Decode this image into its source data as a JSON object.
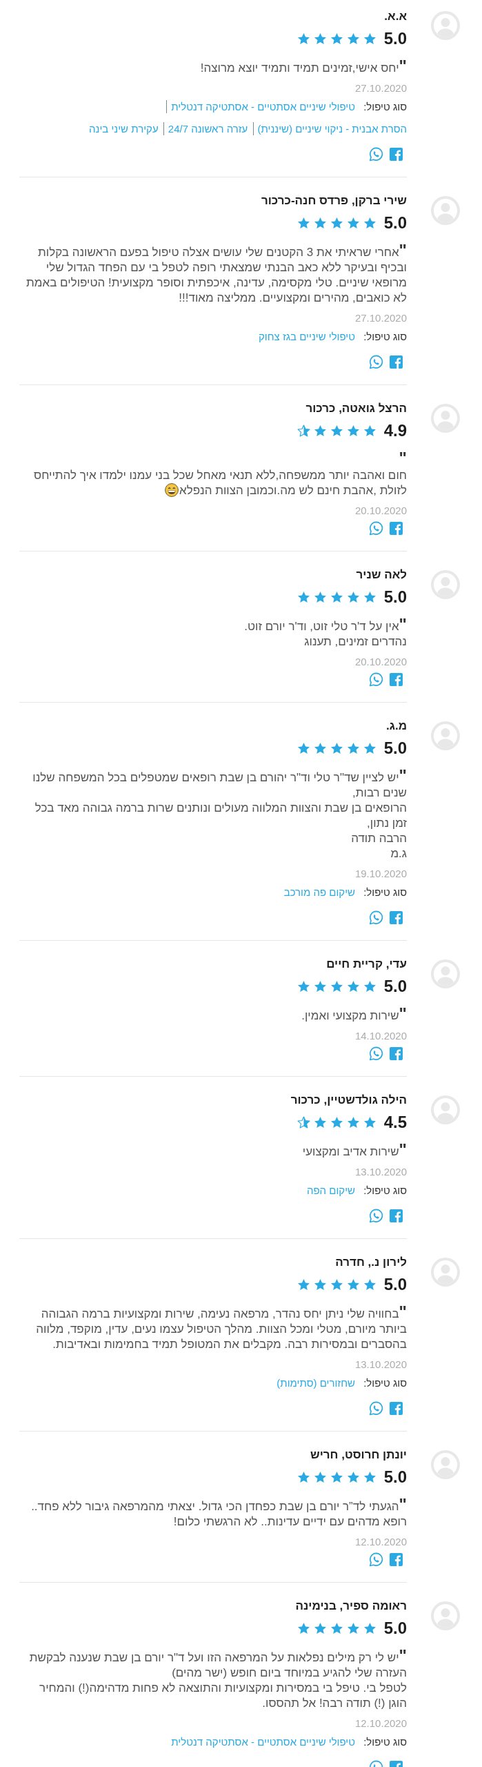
{
  "reviews": [
    {
      "name": "א.א.",
      "score": "5.0",
      "stars": 5,
      "text": "**\"**יחס אישי,זמינים תמיד ותמיד יוצא מרוצה!",
      "date": "27.10.2020",
      "treatment_label": "סוג טיפול:",
      "treatments": [
        "טיפולי שיניים אסתטיים - אסתטיקה דנטלית",
        "הסרת אבנית - ניקוי שיניים (שיננית)",
        "עזרה ראשונה 24/7",
        "עקירת שיני בינה"
      ]
    },
    {
      "name": "שירי ברקן, פרדס חנה-כרכור",
      "score": "5.0",
      "stars": 5,
      "text": "**\"**אחרי שראיתי את 3 הקטנים שלי עושים אצלה טיפול בפעם הראשונה בקלות ובכיף ובעיקר ללא כאב הבנתי שמצאתי רופה לטפל בי עם הפחד הגדול שלי מרופאי שיניים. טלי מקסימה, עדינה, איכפתית וסופר מקצועית! הטיפולים באמת לא כואבים, מהירים ומקצועיים. ממליצה מאוד!!!",
      "date": "27.10.2020",
      "treatment_label": "סוג טיפול:",
      "treatments": [
        "טיפולי שיניים בגז צחוק"
      ]
    },
    {
      "name": "הרצל גואטה, כרכור",
      "score": "4.9",
      "stars": 4.5,
      "text": "**\"**\nחום ואהבה יותר ממשפחה,ללא תנאי מאחל שכל בני עמנו ילמדו איך להתייחס לזולת ,אהבת חינם לש מה.וכמובן הצוות הנפלא",
      "emoji": true,
      "date": "20.10.2020"
    },
    {
      "name": "לאה שניר",
      "score": "5.0",
      "stars": 5,
      "text": "**\"**אין על ד'ר טלי זוט, וד'ר יורם זוט.\nנהדרים זמינים, תענוג",
      "date": "20.10.2020"
    },
    {
      "name": "מ.ג.",
      "score": "5.0",
      "stars": 5,
      "text": "**\"**יש לציין שד\"ר טלי וד\"ר יהורם בן שבת רופאים שמטפלים בכל המשפחה שלנו שנים רבות,\nהרופאים בן שבת והצוות המלווה מעולים ונותנים שרות ברמה גבוהה מאד בכל זמן נתון,\nהרבה תודה\nג.מ",
      "date": "19.10.2020",
      "treatment_label": "סוג טיפול:",
      "treatments": [
        "שיקום פה מורכב"
      ]
    },
    {
      "name": "עדי, קריית חיים",
      "score": "5.0",
      "stars": 5,
      "text": "**\"**שירות מקצועי ואמין.",
      "date": "14.10.2020"
    },
    {
      "name": "הילה גולדשטיין, כרכור",
      "score": "4.5",
      "stars": 4.5,
      "text": "**\"**שירות אדיב ומקצועי",
      "date": "13.10.2020",
      "treatment_label": "סוג טיפול:",
      "treatments": [
        "שיקום הפה"
      ]
    },
    {
      "name": "לירון נ., חדרה",
      "score": "5.0",
      "stars": 5,
      "text": "**\"**בחוויה שלי ניתן יחס נהדר, מרפאה נעימה, שירות ומקצועיות ברמה הגבוהה ביותר מיורם, מטלי ומכל הצוות. מהלך הטיפול עצמו נעים, עדין, מוקפד, מלווה בהסברים ובמסירות רבה. מקבלים את המטופל תמיד בחמימות ובאדיבות.",
      "date": "13.10.2020",
      "treatment_label": "סוג טיפול:",
      "treatments": [
        "שחזורים (סתימות)"
      ]
    },
    {
      "name": "יונתן חרוסט, חריש",
      "score": "5.0",
      "stars": 5,
      "text": "**\"**הגעתי לד”ר יורם בן שבת כפחדן הכי גדול. יצאתי מהמרפאה גיבור ללא פחד.. רופא מדהים עם ידיים עדינות.. לא הרגשתי כלום!",
      "date": "12.10.2020"
    },
    {
      "name": "ראומה ספיר, בנימינה",
      "score": "5.0",
      "stars": 5,
      "text": "**\"**יש לי רק מילים נפלאות על המרפאה הזו ועל ד\"ר יורם בן שבת שנענה לבקשת העזרה שלי להגיע במיוחד ביום חופש (ישר מהים)\nלטפל בי. טיפל בי במסירות ומקצועיות והתוצאה לא פחות מדהימה(!) והמחיר הוגן (!) תודה רבה! אל תהססו.",
      "date": "12.10.2020",
      "treatment_label": "סוג טיפול:",
      "treatments": [
        "טיפולי שיניים אסתטיים - אסתטיקה דנטלית"
      ]
    }
  ]
}
